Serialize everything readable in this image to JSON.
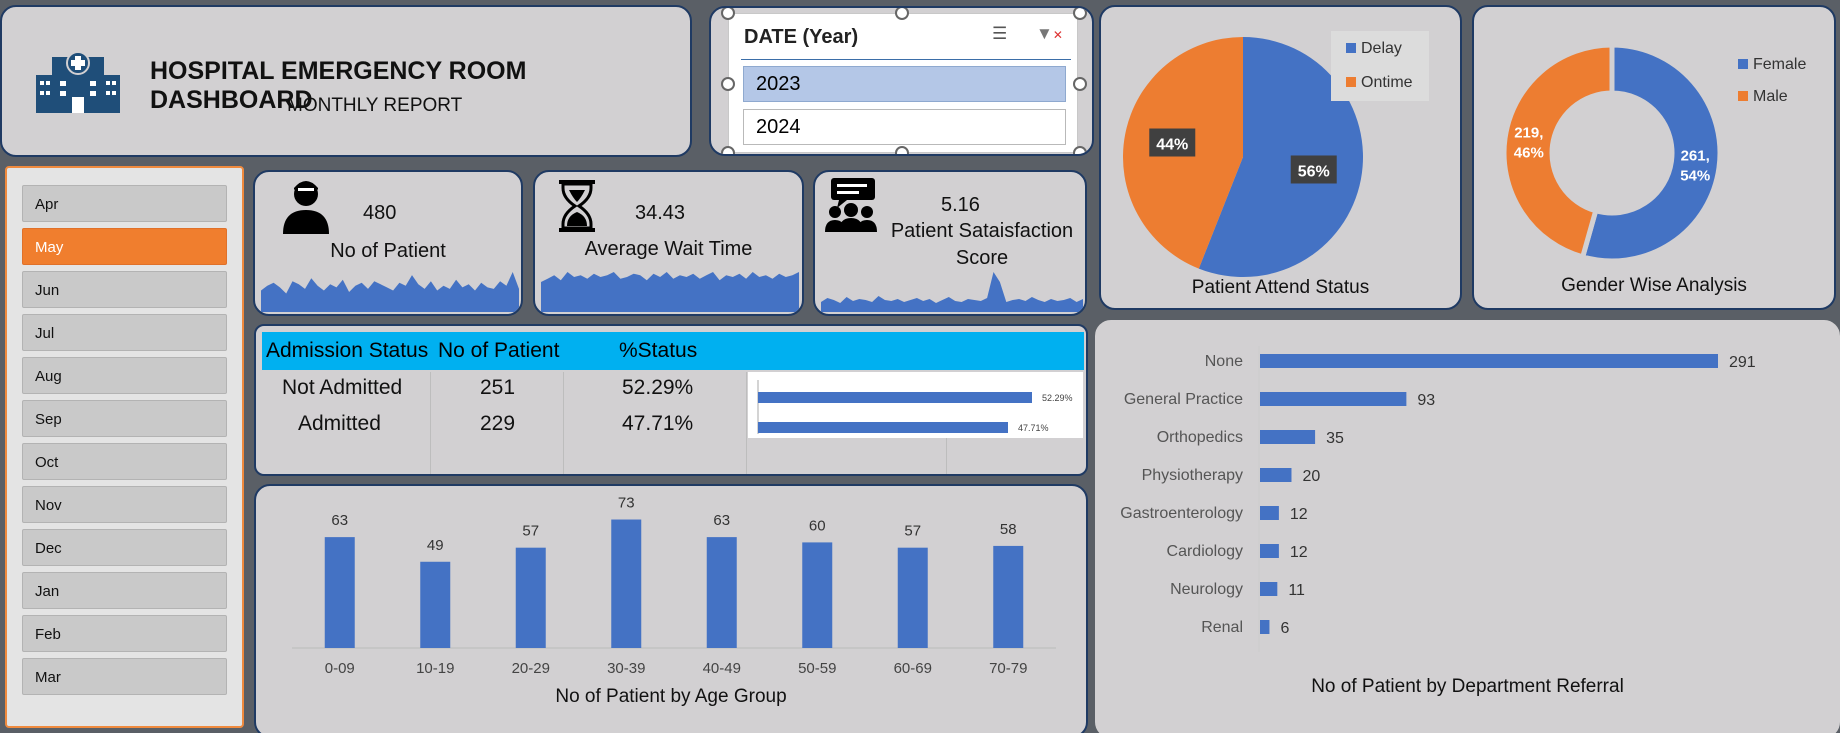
{
  "header": {
    "title": "HOSPITAL EMERGENCY ROOM DASHBOARD",
    "subtitle": "MONTHLY REPORT",
    "icon": "hospital-icon"
  },
  "year_slicer": {
    "label": "DATE (Year)",
    "items": [
      "2023",
      "2024"
    ],
    "selected": "2023"
  },
  "month_slicer": {
    "items": [
      "Apr",
      "May",
      "Jun",
      "Jul",
      "Aug",
      "Sep",
      "Oct",
      "Nov",
      "Dec",
      "Jan",
      "Feb",
      "Mar"
    ],
    "selected": "May"
  },
  "kpis": {
    "patients": {
      "value": "480",
      "label": "No of Patient",
      "icon": "patient-icon",
      "spark": [
        14,
        17,
        19,
        16,
        12,
        20,
        18,
        15,
        22,
        17,
        14,
        18,
        16,
        21,
        13,
        17,
        19,
        15,
        20,
        18,
        16,
        14,
        19,
        17,
        24,
        18,
        15,
        20,
        14,
        17,
        15,
        21,
        16,
        18,
        14,
        19,
        16,
        15,
        20,
        17,
        26,
        15
      ]
    },
    "wait": {
      "value": "34.43",
      "label": "Average Wait Time",
      "icon": "hourglass-icon",
      "spark": [
        18,
        20,
        22,
        19,
        24,
        21,
        22,
        20,
        23,
        21,
        22,
        24,
        20,
        21,
        23,
        22,
        19,
        23,
        21,
        24,
        20,
        22,
        21,
        23,
        20,
        22,
        24,
        19,
        22,
        21,
        23,
        20,
        24,
        21,
        22,
        20,
        23,
        21,
        22,
        24
      ]
    },
    "satisfaction": {
      "value": "5.16",
      "label": "Patient Sataisfaction Score",
      "icon": "feedback-icon",
      "spark": [
        10,
        14,
        12,
        9,
        15,
        11,
        13,
        12,
        10,
        16,
        12,
        11,
        13,
        10,
        12,
        14,
        11,
        13,
        9,
        12,
        15,
        11,
        10,
        13,
        12,
        11,
        14,
        40,
        30,
        10,
        12,
        13,
        11,
        15,
        12,
        10,
        13,
        11,
        12,
        14,
        10,
        13
      ]
    }
  },
  "colors": {
    "blue": "#4472c4",
    "orange": "#ed7d31",
    "cyan": "#00b0f0",
    "selected_month": "#f07e2e"
  },
  "chart_data": [
    {
      "type": "pie",
      "title": "Patient Attend Status",
      "categories": [
        "Delay",
        "Ontime"
      ],
      "values": [
        56,
        44
      ],
      "labels": [
        "56%",
        "44%"
      ],
      "legend": "top-right"
    },
    {
      "type": "pie",
      "title": "Gender Wise Analysis",
      "categories": [
        "Female",
        "Male"
      ],
      "values": [
        261,
        219
      ],
      "labels": [
        "261, 54%",
        "219, 46%"
      ],
      "legend": "top-right"
    },
    {
      "type": "table",
      "columns": [
        "Admission Status",
        "No of Patient",
        "%Status"
      ],
      "rows": [
        [
          "Not Admitted",
          "251",
          "52.29%"
        ],
        [
          "Admitted",
          "229",
          "47.71%"
        ]
      ],
      "bar_values": [
        52.29,
        47.71
      ],
      "bar_labels": [
        "52.29%",
        "47.71%"
      ]
    },
    {
      "type": "bar",
      "title": "No of Patient by Age Group",
      "categories": [
        "0-09",
        "10-19",
        "20-29",
        "30-39",
        "40-49",
        "50-59",
        "60-69",
        "70-79"
      ],
      "values": [
        63,
        49,
        57,
        73,
        63,
        60,
        57,
        58
      ],
      "ylim": [
        0,
        75
      ]
    },
    {
      "type": "bar",
      "orientation": "horizontal",
      "title": "No of Patient by Department Referral",
      "categories": [
        "None",
        "General Practice",
        "Orthopedics",
        "Physiotherapy",
        "Gastroenterology",
        "Cardiology",
        "Neurology",
        "Renal"
      ],
      "values": [
        291,
        93,
        35,
        20,
        12,
        12,
        11,
        6
      ],
      "xlim": [
        0,
        300
      ]
    }
  ]
}
